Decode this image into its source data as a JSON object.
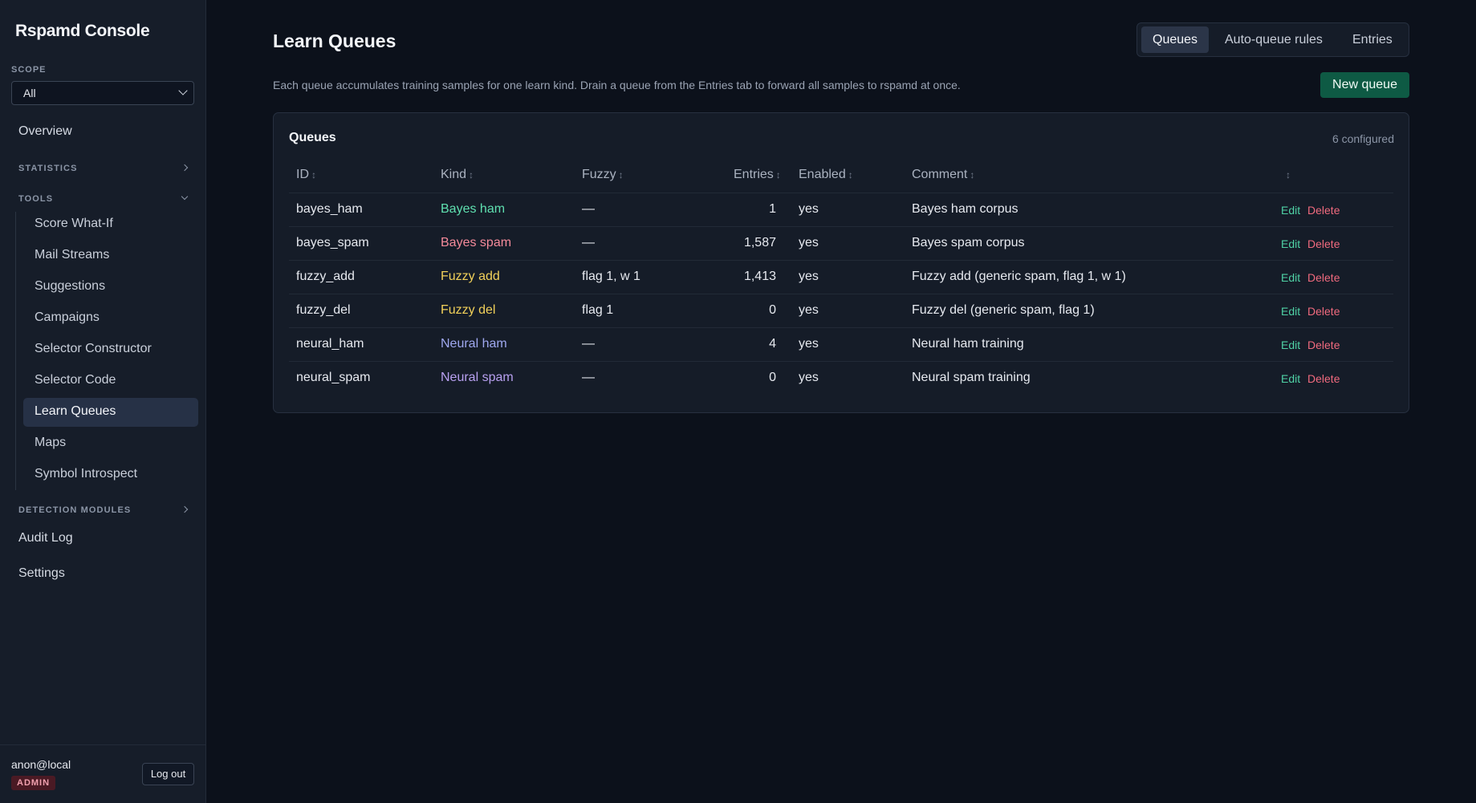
{
  "app": {
    "title": "Rspamd Console"
  },
  "sidebar": {
    "scope_label": "SCOPE",
    "scope_value": "All",
    "overview": "Overview",
    "statistics": "STATISTICS",
    "tools": "TOOLS",
    "tools_items": [
      {
        "label": "Score What-If"
      },
      {
        "label": "Mail Streams"
      },
      {
        "label": "Suggestions"
      },
      {
        "label": "Campaigns"
      },
      {
        "label": "Selector Constructor"
      },
      {
        "label": "Selector Code"
      },
      {
        "label": "Learn Queues",
        "active": true
      },
      {
        "label": "Maps"
      },
      {
        "label": "Symbol Introspect"
      }
    ],
    "detection_modules": "DETECTION MODULES",
    "audit_log": "Audit Log",
    "settings": "Settings",
    "user": "anon@local",
    "role": "ADMIN",
    "logout": "Log out"
  },
  "header": {
    "title": "Learn Queues",
    "tabs": [
      {
        "label": "Queues",
        "active": true
      },
      {
        "label": "Auto-queue rules"
      },
      {
        "label": "Entries"
      }
    ],
    "description": "Each queue accumulates training samples for one learn kind. Drain a queue from the Entries tab to forward all samples to rspamd at once.",
    "new_queue": "New queue"
  },
  "queues": {
    "title": "Queues",
    "count": "6 configured",
    "columns": {
      "id": "ID",
      "kind": "Kind",
      "fuzzy": "Fuzzy",
      "entries": "Entries",
      "enabled": "Enabled",
      "comment": "Comment",
      "actions": "",
      "sort_glyph": "↕"
    },
    "rows": [
      {
        "id": "bayes_ham",
        "kind": "Bayes ham",
        "kind_color": "#5fe0b0",
        "fuzzy": "—",
        "entries": "1",
        "enabled": "yes",
        "comment": "Bayes ham corpus",
        "edit": "Edit",
        "delete": "Delete"
      },
      {
        "id": "bayes_spam",
        "kind": "Bayes spam",
        "kind_color": "#f48a9a",
        "fuzzy": "—",
        "entries": "1,587",
        "enabled": "yes",
        "comment": "Bayes spam corpus",
        "edit": "Edit",
        "delete": "Delete"
      },
      {
        "id": "fuzzy_add",
        "kind": "Fuzzy add",
        "kind_color": "#f2d15a",
        "fuzzy": "flag 1, w 1",
        "entries": "1,413",
        "enabled": "yes",
        "comment": "Fuzzy add (generic spam, flag 1, w 1)",
        "edit": "Edit",
        "delete": "Delete"
      },
      {
        "id": "fuzzy_del",
        "kind": "Fuzzy del",
        "kind_color": "#f2d15a",
        "fuzzy": "flag 1",
        "entries": "0",
        "enabled": "yes",
        "comment": "Fuzzy del (generic spam, flag 1)",
        "edit": "Edit",
        "delete": "Delete"
      },
      {
        "id": "neural_ham",
        "kind": "Neural ham",
        "kind_color": "#9fa8f0",
        "fuzzy": "—",
        "entries": "4",
        "enabled": "yes",
        "comment": "Neural ham training",
        "edit": "Edit",
        "delete": "Delete"
      },
      {
        "id": "neural_spam",
        "kind": "Neural spam",
        "kind_color": "#b8a0f0",
        "fuzzy": "—",
        "entries": "0",
        "enabled": "yes",
        "comment": "Neural spam training",
        "edit": "Edit",
        "delete": "Delete"
      }
    ]
  }
}
